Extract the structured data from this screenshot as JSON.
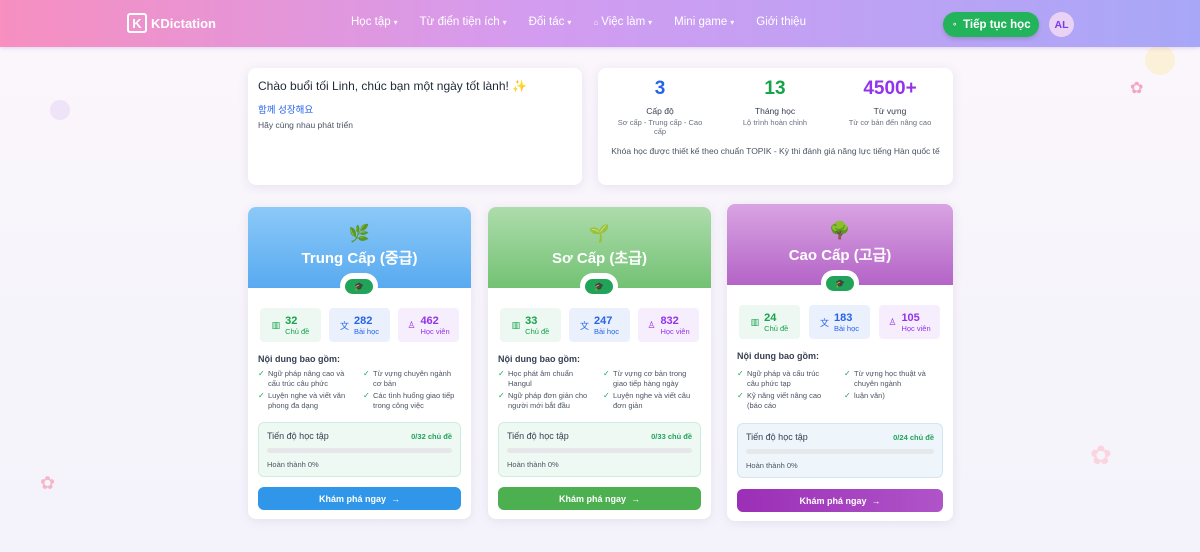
{
  "nav": {
    "logo_text": "KDictation",
    "logo_mark": "K",
    "items": [
      {
        "label": "Học tập",
        "chevron": true,
        "prefix": ""
      },
      {
        "label": "Từ điển tiện ích",
        "chevron": true,
        "prefix": ""
      },
      {
        "label": "Đối tác",
        "chevron": true,
        "prefix": ""
      },
      {
        "label": "Việc làm",
        "chevron": true,
        "prefix": "⌂"
      },
      {
        "label": "Mini game",
        "chevron": true,
        "prefix": ""
      },
      {
        "label": "Giới thiệu",
        "chevron": false,
        "prefix": ""
      }
    ],
    "continue_label": "Tiếp tục học",
    "avatar_initials": "AL"
  },
  "greeting": {
    "title": "Chào buổi tối Linh, chúc bạn một ngày tốt lành! ✨",
    "korean": "함께 성장해요",
    "subtitle": "Hãy cùng nhau phát triển"
  },
  "stats": {
    "items": [
      {
        "value": "3",
        "label": "Cấp độ",
        "desc": "Sơ cấp - Trung cấp - Cao cấp",
        "color": "#2563eb"
      },
      {
        "value": "13",
        "label": "Tháng học",
        "desc": "Lộ trình hoàn chỉnh",
        "color": "#16a34a"
      },
      {
        "value": "4500+",
        "label": "Từ vựng",
        "desc": "Từ cơ bản đến nâng cao",
        "color": "#9333ea"
      }
    ],
    "note": "Khóa học được thiết kế theo chuẩn TOPIK - Kỳ thi đánh giá năng lực tiếng Hàn quốc tế"
  },
  "levels": [
    {
      "icon": "🌿",
      "name": "Trung Cấp (중급)",
      "head_color_top": "#7cc0f7",
      "head_color_bottom": "#4aa3ef",
      "stats": [
        {
          "value": "32",
          "label": "Chủ đề",
          "icon": "book-icon"
        },
        {
          "value": "282",
          "label": "Bài học",
          "icon": "translate-icon"
        },
        {
          "value": "462",
          "label": "Học viên",
          "icon": "users-icon"
        }
      ],
      "includes_title": "Nội dung bao gồm:",
      "features": [
        "Ngữ pháp nâng cao và cấu trúc câu phức",
        "Từ vựng chuyên ngành cơ bản",
        "Luyện nghe và viết văn phong đa dạng",
        "Các tình huống giao tiếp trong công việc"
      ],
      "progress_title": "Tiến độ học tập",
      "progress_count": "0/32 chủ đề",
      "progress_value": 0,
      "progress_done": "Hoàn thành 0%",
      "cta_label": "Khám phá ngay",
      "cta_color": "#2f96ea"
    },
    {
      "icon": "🌱",
      "name": "Sơ Cấp (초급)",
      "head_color_top": "#a6dba6",
      "head_color_bottom": "#6cbf6e",
      "stats": [
        {
          "value": "33",
          "label": "Chủ đề",
          "icon": "book-icon"
        },
        {
          "value": "247",
          "label": "Bài học",
          "icon": "translate-icon"
        },
        {
          "value": "832",
          "label": "Học viên",
          "icon": "users-icon"
        }
      ],
      "includes_title": "Nội dung bao gồm:",
      "features": [
        "Học phát âm chuẩn Hangul",
        "Từ vựng cơ bản trong giao tiếp hàng ngày",
        "Ngữ pháp đơn giản cho người mới bắt đầu",
        "Luyện nghe và viết câu đơn giản"
      ],
      "progress_title": "Tiến độ học tập",
      "progress_count": "0/33 chủ đề",
      "progress_value": 0,
      "progress_done": "Hoàn thành 0%",
      "cta_label": "Khám phá ngay",
      "cta_color": "#4caf50"
    },
    {
      "icon": "🌳",
      "name": "Cao Cấp (고급)",
      "head_color_top": "#d79fe0",
      "head_color_bottom": "#b05cc4",
      "stats": [
        {
          "value": "24",
          "label": "Chủ đề",
          "icon": "book-icon"
        },
        {
          "value": "183",
          "label": "Bài học",
          "icon": "translate-icon"
        },
        {
          "value": "105",
          "label": "Học viên",
          "icon": "users-icon"
        }
      ],
      "includes_title": "Nội dung bao gồm:",
      "features": [
        "Ngữ pháp và cấu trúc câu phức tạp",
        "Từ vựng học thuật và chuyên ngành",
        "Kỹ năng viết nâng cao (báo cáo",
        "luận văn)"
      ],
      "progress_title": "Tiến độ học tập",
      "progress_count": "0/24 chủ đề",
      "progress_value": 0,
      "progress_done": "Hoàn thành 0%",
      "cta_label": "Khám phá ngay",
      "cta_color": "#9c2fb8"
    }
  ]
}
